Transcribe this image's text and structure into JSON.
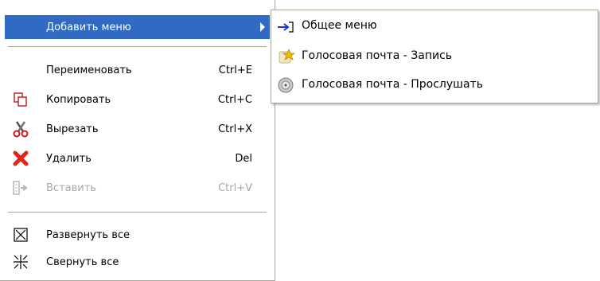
{
  "menu": {
    "add_menu": {
      "label": "Добавить меню"
    },
    "items": [
      {
        "label": "Переименовать",
        "shortcut": "Ctrl+E"
      },
      {
        "label": "Копировать",
        "shortcut": "Ctrl+C"
      },
      {
        "label": "Вырезать",
        "shortcut": "Ctrl+X"
      },
      {
        "label": "Удалить",
        "shortcut": "Del"
      },
      {
        "label": "Вставить",
        "shortcut": "Ctrl+V"
      },
      {
        "label": "Развернуть все"
      },
      {
        "label": "Свернуть все"
      }
    ]
  },
  "submenu": {
    "items": [
      {
        "label": "Общее меню",
        "icon": "share-arrow-icon"
      },
      {
        "label": "Голосовая почта - Запись",
        "icon": "voicemail-record-icon"
      },
      {
        "label": "Голосовая почта - Прослушать",
        "icon": "voicemail-listen-icon"
      }
    ]
  },
  "colors": {
    "highlight": "#316ac5",
    "disabled_text": "#a7a7a7",
    "border": "#aca899"
  }
}
